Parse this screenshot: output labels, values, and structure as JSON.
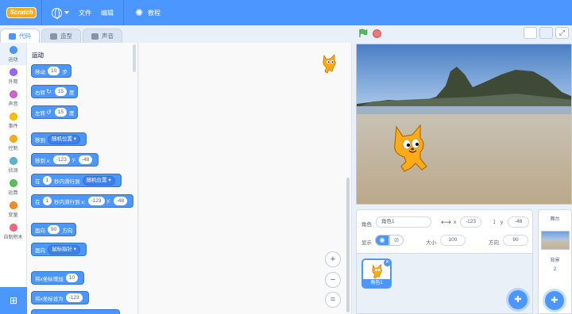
{
  "menubar": {
    "logo": "Scratch",
    "file": "文件",
    "edit": "编辑",
    "tutorials": "教程"
  },
  "tabs": [
    {
      "label": "代码"
    },
    {
      "label": "造型"
    },
    {
      "label": "声音"
    }
  ],
  "categories": [
    {
      "label": "运动",
      "color": "#4c97ff"
    },
    {
      "label": "外观",
      "color": "#9966ff"
    },
    {
      "label": "声音",
      "color": "#cf63cf"
    },
    {
      "label": "事件",
      "color": "#ffbf00"
    },
    {
      "label": "控制",
      "color": "#ffab19"
    },
    {
      "label": "侦测",
      "color": "#5cb1d6"
    },
    {
      "label": "运算",
      "color": "#59c059"
    },
    {
      "label": "变量",
      "color": "#ff8c1a"
    },
    {
      "label": "自制积木",
      "color": "#ff6680"
    }
  ],
  "palette": {
    "title": "运动",
    "blocks": {
      "move": {
        "a": "移动",
        "v": "10",
        "b": "步"
      },
      "turn_right": {
        "a": "右转",
        "v": "15",
        "b": "度"
      },
      "turn_left": {
        "a": "左转",
        "v": "15",
        "b": "度"
      },
      "goto": {
        "a": "移到",
        "dd": "随机位置"
      },
      "goto_xy": {
        "a": "移到 x:",
        "x": "-123",
        "y_label": "y:",
        "y": "-48"
      },
      "glide_to": {
        "a": "在",
        "v": "1",
        "b": "秒内滑行到",
        "dd": "随机位置"
      },
      "glide_xy": {
        "a": "在",
        "v": "1",
        "b": "秒内滑行到 x:",
        "x": "-123",
        "y_label": "y:",
        "y": "-48"
      },
      "point_dir": {
        "a": "面向",
        "v": "90",
        "b": "方向"
      },
      "point_towards": {
        "a": "面向",
        "dd": "鼠标指针"
      },
      "change_x": {
        "a": "将x坐标增加",
        "v": "10"
      },
      "set_x": {
        "a": "将x坐标设为",
        "v": "-123"
      }
    }
  },
  "sprite_info": {
    "sprite_label": "角色",
    "sprite_name": "角色1",
    "x_label": "x",
    "x": "-123",
    "y_label": "y",
    "y": "-48",
    "show_label": "显示",
    "size_label": "大小",
    "size": "100",
    "direction_label": "方向",
    "direction": "90"
  },
  "sprites": [
    {
      "name": "角色1"
    }
  ],
  "backdrop": {
    "title": "舞台",
    "label": "背景",
    "count": "2"
  },
  "colors": {
    "accent": "#4c97ff",
    "stop": "#ec7a7a",
    "flag": "#4cbf56"
  }
}
